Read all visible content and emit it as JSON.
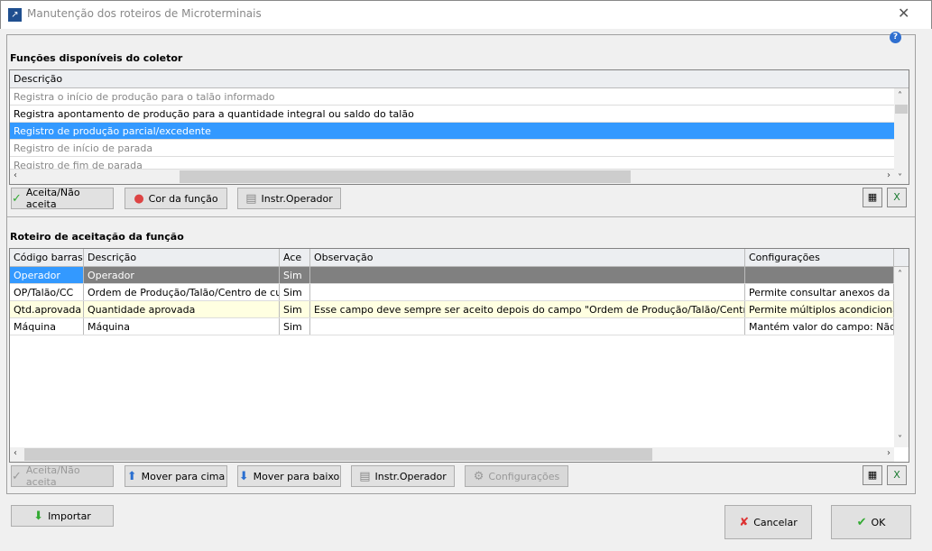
{
  "window": {
    "title": "Manutenção dos roteiros de Microterminais",
    "close": "✕",
    "help": "?"
  },
  "functions": {
    "section_title": "Funções disponíveis do coletor",
    "column": "Descrição",
    "rows": [
      "Registra o início de produção para o talão informado",
      "Registra apontamento de produção para a quantidade integral ou saldo do talão",
      "Registro de produção parcial/excedente",
      "Registro de início de parada",
      "Registro de fim de parada"
    ],
    "buttons": {
      "accept": "Aceita/Não aceita",
      "color": "Cor da função",
      "instr": "Instr.Operador"
    }
  },
  "script": {
    "section_title": "Roteiro de aceitação da função",
    "columns": [
      "Código barras",
      "Descrição",
      "Ace",
      "Observação",
      "Configurações"
    ],
    "rows": [
      [
        "Operador",
        "Operador",
        "Sim",
        "",
        ""
      ],
      [
        "OP/Talão/CC",
        "Ordem de Produção/Talão/Centro de custo",
        "Sim",
        "",
        "Permite consultar anexos da Form"
      ],
      [
        "Qtd.aprovada",
        "Quantidade aprovada",
        "Sim",
        "Esse campo deve sempre ser aceito depois do campo \"Ordem de Produção/Talão/Centro de custo\"",
        "Permite múltiplos acondicionament"
      ],
      [
        "Máquina",
        "Máquina",
        "Sim",
        "",
        "Mantém valor do campo: Não"
      ]
    ],
    "buttons": {
      "accept": "Aceita/Não aceita",
      "up": "Mover para cima",
      "down": "Mover para baixo",
      "instr": "Instr.Operador",
      "config": "Configurações"
    }
  },
  "footer": {
    "import": "Importar",
    "cancel": "Cancelar",
    "ok": "OK"
  },
  "colors": {
    "selection": "#3399ff",
    "selected_row": "#808080",
    "highlight_row": "#ffffe1"
  }
}
